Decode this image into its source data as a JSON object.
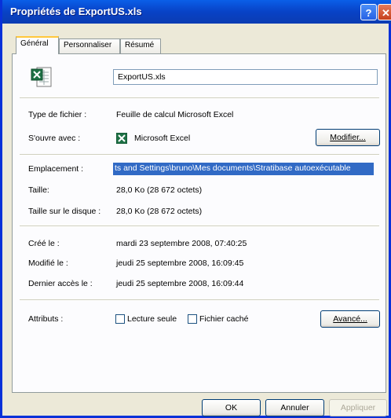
{
  "window": {
    "title": "Propriétés de ExportUS.xls",
    "help_glyph": "?",
    "close_glyph": "✕"
  },
  "tabs": [
    {
      "label": "Général"
    },
    {
      "label": "Personnaliser"
    },
    {
      "label": "Résumé"
    }
  ],
  "file": {
    "name": "ExportUS.xls",
    "icon": "excel-file-icon"
  },
  "fields": {
    "type_label": "Type de fichier :",
    "type_value": "Feuille de calcul Microsoft Excel",
    "opens_label": "S'ouvre avec :",
    "opens_value": "Microsoft Excel",
    "change_button": "Modifier...",
    "location_label": "Emplacement :",
    "location_value": "ts and Settings\\bruno\\Mes documents\\Stratibase autoexécutable",
    "size_label": "Taille:",
    "size_value": "28,0 Ko (28 672 octets)",
    "disk_size_label": "Taille sur le disque :",
    "disk_size_value": "28,0 Ko (28 672 octets)",
    "created_label": "Créé le :",
    "created_value": "mardi 23 septembre 2008, 07:40:25",
    "modified_label": "Modifié le :",
    "modified_value": "jeudi 25 septembre 2008, 16:09:45",
    "accessed_label": "Dernier accès le :",
    "accessed_value": "jeudi 25 septembre 2008, 16:09:44",
    "attributes_label": "Attributs :",
    "readonly_label": "Lecture seule",
    "hidden_label": "Fichier caché",
    "advanced_button": "Avancé..."
  },
  "buttons": {
    "ok": "OK",
    "cancel": "Annuler",
    "apply": "Appliquer"
  },
  "colors": {
    "titlebar": "#0A5FE8",
    "selection": "#316AC5",
    "excel_green": "#1E7145"
  }
}
